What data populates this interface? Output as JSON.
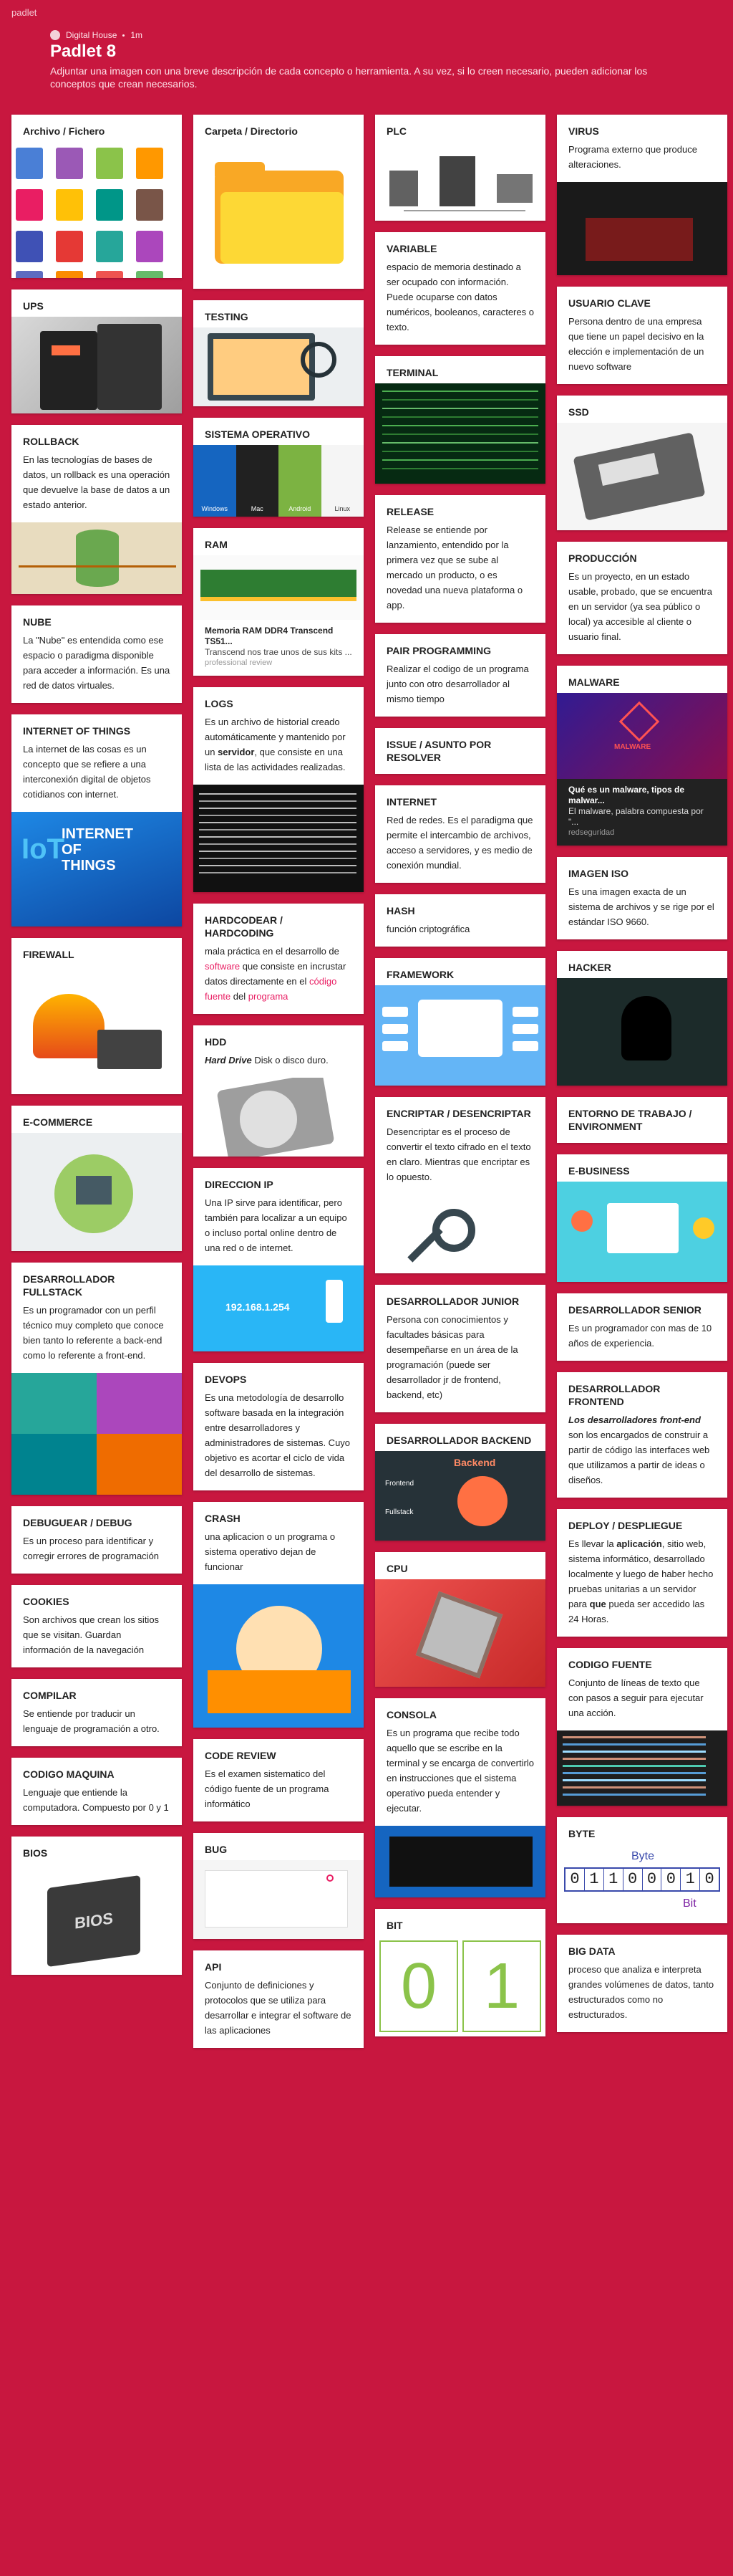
{
  "topbar": {
    "brand": "padlet"
  },
  "header": {
    "author": "Digital House",
    "time": "1m",
    "title": "Padlet 8",
    "description": "Adjuntar una imagen con una breve descripción de cada concepto o herramienta. A su vez, si lo creen necesario, pueden adicionar los conceptos que crean necesarios."
  },
  "col1": [
    {
      "title": "Archivo / Fichero"
    },
    {
      "title": "UPS"
    },
    {
      "title": "ROLLBACK",
      "body": "En las tecnologías de bases de datos, un rollback es una operación que devuelve la base de datos a un estado anterior."
    },
    {
      "title": "NUBE",
      "body": "La \"Nube\" es entendida como ese espacio o paradigma disponible para acceder a información. Es una red de datos virtuales."
    },
    {
      "title": "INTERNET OF THINGS",
      "body": "La internet de las cosas  es un concepto que se refiere a una interconexión digital de objetos cotidianos con internet.",
      "img_text": [
        "INTERNET",
        "OF",
        "THINGS"
      ]
    },
    {
      "title": "FIREWALL"
    },
    {
      "title": "E-COMMERCE"
    },
    {
      "title": "DESARROLLADOR FULLSTACK",
      "body": "Es un programador con un perfil técnico muy completo que conoce bien tanto lo referente a back-end como lo referente a front-end."
    },
    {
      "title": "DEBUGUEAR / DEBUG",
      "body": "Es un proceso para identificar y corregir errores de programación"
    },
    {
      "title": "COOKIES",
      "body": "Son archivos que crean los sitios que se visitan. Guardan información de la navegación"
    },
    {
      "title": "COMPILAR",
      "body": "Se entiende por traducir un lenguaje de programación a otro."
    },
    {
      "title": "CODIGO MAQUINA",
      "body": "Lenguaje que entiende la computadora. Compuesto por 0 y 1"
    },
    {
      "title": "BIOS",
      "img_text": "BIOS"
    }
  ],
  "col2": [
    {
      "title": "Carpeta / Directorio"
    },
    {
      "title": "TESTING"
    },
    {
      "title": "SISTEMA OPERATIVO",
      "os": [
        "Windows",
        "Mac",
        "Android",
        "Linux"
      ]
    },
    {
      "title": "RAM",
      "link_title": "Memoria RAM DDR4 Transcend TS51...",
      "link_desc": "Transcend nos trae unos de sus kits ...",
      "link_src": "professional review"
    },
    {
      "title": "LOGS",
      "body_pre": "Es un archivo de historial creado automáticamente y mantenido por un ",
      "body_bold": "servidor",
      "body_post": ", que consiste en una lista de las actividades realizadas."
    },
    {
      "title": "HARDCODEAR / HARDCODING",
      "body_pre": "mala práctica en el desarrollo de ",
      "body_l1": "software",
      "body_mid": " que consiste en incrustar datos directamente en el ",
      "body_l2": "código fuente",
      "body_mid2": " del ",
      "body_l3": "programa"
    },
    {
      "title": "HDD",
      "body_bold": "Hard Drive",
      "body_post": " Disk o disco duro."
    },
    {
      "title": "DIRECCION IP",
      "body": "Una IP sirve para identificar, pero también para localizar a un equipo o incluso portal online dentro de una red o de internet.",
      "img_text": "192.168.1.254"
    },
    {
      "title": "DEVOPS",
      "body": "Es una metodología de desarrollo software basada en la integración entre desarrolladores y administradores de sistemas. Cuyo objetivo es acortar el ciclo de vida del desarrollo de sistemas."
    },
    {
      "title": "CRASH",
      "body": "una aplicacion o un programa o sistema operativo dejan de funcionar"
    },
    {
      "title": "CODE REVIEW",
      "body": "Es el examen sistematico del código fuente de un programa informático"
    },
    {
      "title": "BUG"
    },
    {
      "title": "API",
      "body": "Conjunto de definiciones y protocolos que se utiliza para desarrollar e integrar el software de las aplicaciones"
    }
  ],
  "col3": [
    {
      "title": "PLC"
    },
    {
      "title": "VARIABLE",
      "body": "espacio de memoria destinado a ser ocupado con información. Puede ocuparse con datos numéricos, booleanos, caracteres o texto."
    },
    {
      "title": "TERMINAL"
    },
    {
      "title": "RELEASE",
      "body": "Release se entiende por lanzamiento, entendido por la primera vez que se sube al mercado un producto, o es novedad una nueva plataforma o app."
    },
    {
      "title": "PAIR PROGRAMMING",
      "body": "Realizar el codigo de un programa junto con otro desarrollador al mismo tiempo"
    },
    {
      "title": "ISSUE / ASUNTO POR RESOLVER"
    },
    {
      "title": "INTERNET",
      "body": "Red de redes. Es el paradigma que permite el intercambio de archivos, acceso a servidores, y es medio de conexión mundial."
    },
    {
      "title": "HASH",
      "body": "función criptográfica"
    },
    {
      "title": "FRAMEWORK"
    },
    {
      "title": "ENCRIPTAR / DESENCRIPTAR",
      "body": "Desencriptar es el proceso de convertir el texto cifrado en el texto en claro. Mientras que encriptar es lo opuesto."
    },
    {
      "title": "DESARROLLADOR JUNIOR",
      "body": "Persona con conocimientos y facultades básicas para desempeñarse en un área de la programación (puede ser desarrollador jr de frontend, backend, etc)"
    },
    {
      "title": "DESARROLLADOR BACKEND",
      "img_labels": [
        "Backend",
        "Frontend",
        "Fullstack"
      ]
    },
    {
      "title": "CPU"
    },
    {
      "title": "CONSOLA",
      "body": "Es un programa que recibe todo aquello que se escribe en la terminal y se encarga de convertirlo en instrucciones que el sistema operativo pueda entender y ejecutar."
    },
    {
      "title": "BIT",
      "img_text": [
        "0",
        "1"
      ]
    }
  ],
  "col4": [
    {
      "title": "VIRUS",
      "body": "Programa externo que produce alteraciones."
    },
    {
      "title": "USUARIO CLAVE",
      "body": "Persona dentro de una empresa que tiene un papel decisivo en la elección e implementación de un nuevo software"
    },
    {
      "title": "SSD"
    },
    {
      "title": "PRODUCCIÓN",
      "body": "Es un proyecto, en un estado usable, probado, que se encuentra en un servidor (ya sea público o local) ya accesible al cliente o usuario final."
    },
    {
      "title": "MALWARE",
      "link_title": "Qué es un malware, tipos de malwar...",
      "link_desc": "El malware, palabra compuesta por \"...",
      "link_src": "redseguridad",
      "img_text": "MALWARE"
    },
    {
      "title": "IMAGEN ISO",
      "body": "Es una imagen exacta de un sistema de archivos y se rige por el estándar ISO 9660."
    },
    {
      "title": "HACKER"
    },
    {
      "title": "ENTORNO DE TRABAJO / ENVIRONMENT"
    },
    {
      "title": "E-BUSINESS"
    },
    {
      "title": "DESARROLLADOR SENIOR",
      "body": "Es un programador con mas de 10 años de experiencia."
    },
    {
      "title": "DESARROLLADOR FRONTEND",
      "body_bold": "Los desarrolladores front-end",
      "body_post": " son los encargados de construir a partir de código las interfaces web que utilizamos a partir de ideas o diseños."
    },
    {
      "title": "DEPLOY / DESPLIEGUE",
      "body_pre": "Es llevar la ",
      "body_b1": "aplicación",
      "body_mid": ", sitio web, sistema informático, desarrollado localmente y luego de haber hecho pruebas unitarias a un servidor para ",
      "body_b2": "que",
      "body_post": " pueda ser accedido las 24 Horas."
    },
    {
      "title": "CODIGO FUENTE",
      "body": "Conjunto de líneas de texto que con pasos a seguir para ejecutar una acción."
    },
    {
      "title": "BYTE",
      "img_text": [
        "Byte",
        "0",
        "1",
        "1",
        "0",
        "0",
        "0",
        "1",
        "0",
        "Bit"
      ]
    },
    {
      "title": "BIG DATA",
      "body": " proceso que analiza e interpreta grandes volúmenes de datos, tanto estructurados como no estructurados."
    }
  ]
}
